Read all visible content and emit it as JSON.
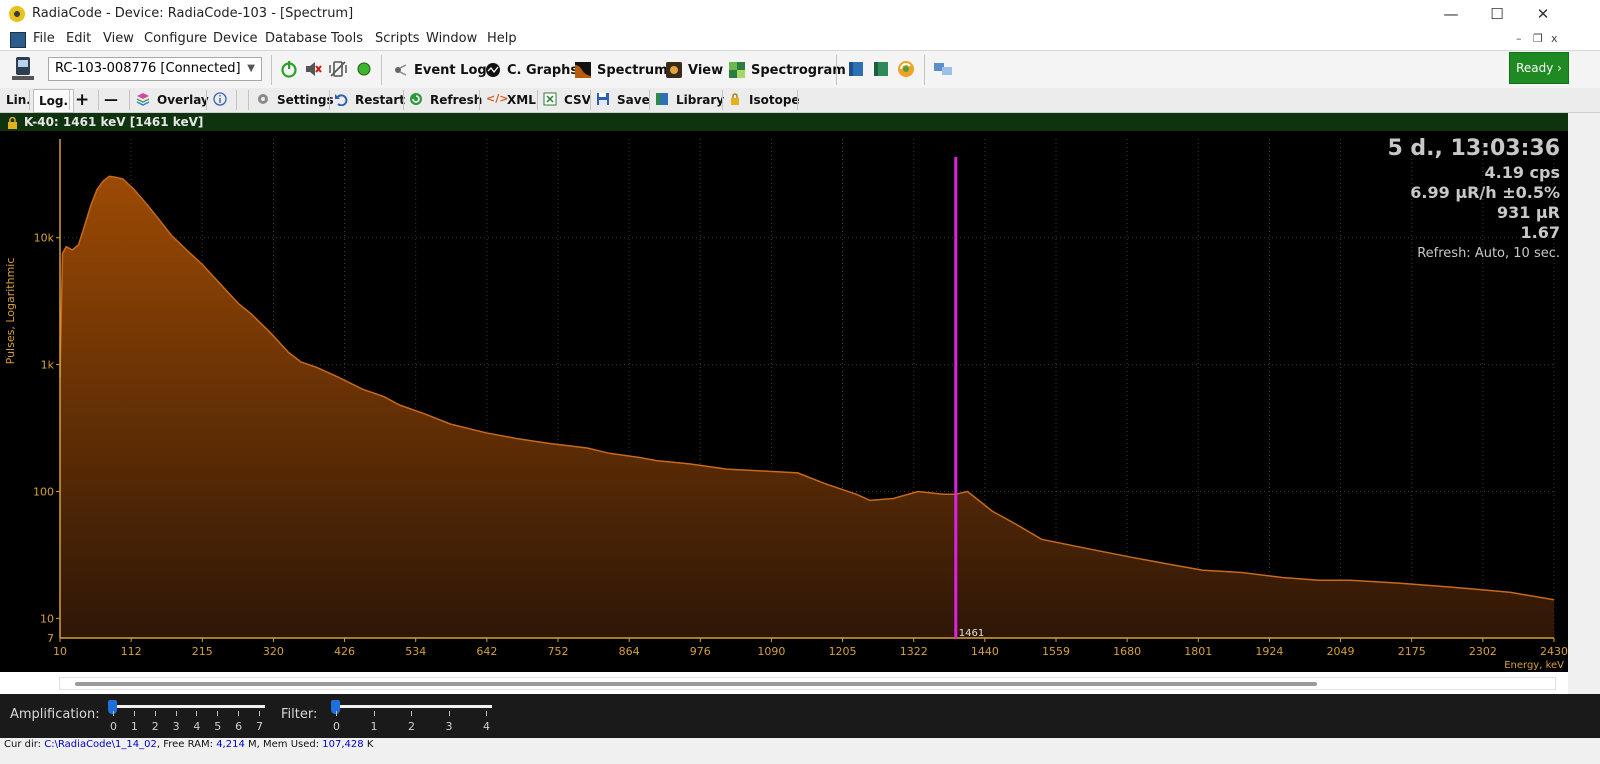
{
  "window": {
    "title": "RadiaCode - Device: RadiaCode-103 - [Spectrum]",
    "controls": {
      "minimize": "—",
      "maximize": "☐",
      "close": "✕"
    }
  },
  "menu": {
    "items": [
      "File",
      "Edit",
      "View",
      "Configure",
      "Device",
      "Database",
      "Tools",
      "Scripts",
      "Window",
      "Help"
    ],
    "mdi_controls": {
      "minimize": "–",
      "restore": "❐",
      "close": "x"
    }
  },
  "toolbar": {
    "device_value": "RC-103-008776 [Connected]",
    "event_log": "Event Log",
    "c_graphs": "C. Graphs",
    "spectrum": "Spectrum",
    "view": "View",
    "spectrogram": "Spectrogram",
    "ready": "Ready ›"
  },
  "toolbar2": {
    "lin": "Lin.",
    "log": "Log.",
    "plus": "+",
    "minus": "—",
    "overlay": "Overlay",
    "settings": "Settings",
    "restart": "Restart",
    "refresh": "Refresh",
    "xml": "XML",
    "csv": "CSV",
    "save": "Save",
    "library": "Library",
    "isotope": "Isotope"
  },
  "isotope_bar": {
    "text": "K-40: 1461 keV [1461 keV]"
  },
  "stats": {
    "duration": "5 d., 13:03:36",
    "cps": "4.19 cps",
    "dose_rate": "6.99 µR/h ±0.5%",
    "dose": "931 µR",
    "ratio": "1.67",
    "refresh": "Refresh: Auto, 10 sec."
  },
  "chart_data": {
    "type": "area",
    "ylabel": "Pulses, Logarithmic",
    "xlabel": "Energy, keV",
    "y_scale": "log",
    "y_ticks": [
      10,
      100,
      1000,
      10000
    ],
    "y_tick_labels": [
      "10",
      "100",
      "1k",
      "10k"
    ],
    "y_min_label": "7",
    "x_tick_labels": [
      "10",
      "112",
      "215",
      "320",
      "426",
      "534",
      "642",
      "752",
      "864",
      "976",
      "1090",
      "1205",
      "1322",
      "1440",
      "1559",
      "1680",
      "1801",
      "1924",
      "2049",
      "2175",
      "2302",
      "2430"
    ],
    "xlim": [
      10,
      2430
    ],
    "ylim": [
      7,
      60000
    ],
    "fill_color": "#9c4a04",
    "line_color": "#c76a1a",
    "grid": true,
    "marker": {
      "energy": 1461,
      "label": "1461",
      "color": "#e020e0"
    },
    "series": [
      {
        "x": [
          10,
          14,
          20,
          30,
          40,
          50,
          60,
          70,
          80,
          90,
          100,
          112,
          130,
          150,
          170,
          190,
          215,
          240,
          270,
          300,
          320,
          350,
          380,
          400,
          426,
          460,
          500,
          534,
          560,
          600,
          642,
          700,
          752,
          800,
          864,
          900,
          950,
          976,
          1030,
          1090,
          1150,
          1205,
          1250,
          1300,
          1322,
          1360,
          1400,
          1440,
          1461,
          1480,
          1520,
          1559,
          1600,
          1680,
          1750,
          1801,
          1860,
          1924,
          1990,
          2049,
          2100,
          2175,
          2240,
          2302,
          2360,
          2430
        ],
        "y": [
          800,
          7500,
          8500,
          8000,
          8800,
          12500,
          18000,
          24000,
          28000,
          30500,
          30000,
          29000,
          24000,
          18500,
          14000,
          10500,
          8000,
          6200,
          4300,
          3000,
          2500,
          1800,
          1250,
          1050,
          950,
          800,
          640,
          560,
          480,
          410,
          340,
          290,
          260,
          240,
          220,
          200,
          185,
          175,
          165,
          150,
          145,
          140,
          115,
          95,
          85,
          88,
          100,
          95,
          95,
          100,
          70,
          55,
          42,
          35,
          30,
          27,
          24,
          23,
          21,
          20,
          20,
          19,
          18,
          17,
          16,
          14
        ]
      }
    ]
  },
  "sliders": {
    "amplification": {
      "label": "Amplification:",
      "value": 0,
      "ticks": [
        "0",
        "1",
        "2",
        "3",
        "4",
        "5",
        "6",
        "7"
      ]
    },
    "filter": {
      "label": "Filter:",
      "value": 0,
      "ticks": [
        "0",
        "1",
        "2",
        "3",
        "4"
      ]
    }
  },
  "statusbar": {
    "cur_dir_label": "Cur dir: ",
    "cur_dir": "C:\\RadiaCode\\1_14_02",
    "free_ram_label": ", Free RAM: ",
    "free_ram": "4,214",
    "mem_used_label": " M, Mem Used: ",
    "mem_used": "107,428",
    "mem_unit": " K"
  }
}
